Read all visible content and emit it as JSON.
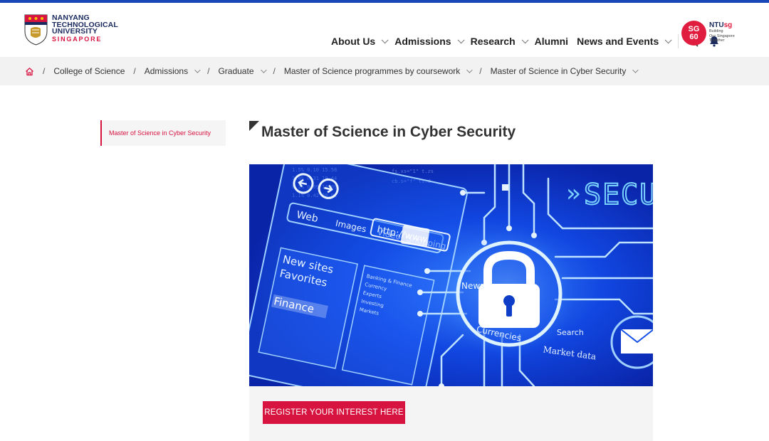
{
  "brand": {
    "line1": "NANYANG",
    "line2": "TECHNOLOGICAL",
    "line3": "UNIVERSITY",
    "line4": "SINGAPORE",
    "sg60_line1": "SG",
    "sg60_line2": "60",
    "ntusg_prefix": "NTU",
    "ntusg_suffix": "sg",
    "ntusg_tag1": "Building",
    "ntusg_tag2": "Our Singapore",
    "ntusg_tag3": "Together"
  },
  "nav": {
    "items": [
      {
        "label": "About Us"
      },
      {
        "label": "Admissions"
      },
      {
        "label": "Research"
      },
      {
        "label": "Alumni"
      },
      {
        "label": "News and Events"
      }
    ]
  },
  "breadcrumb": {
    "items": [
      {
        "label": "College of Science"
      },
      {
        "label": "Admissions"
      },
      {
        "label": "Graduate"
      },
      {
        "label": "Master of Science programmes by coursework"
      },
      {
        "label": "Master of Science in Cyber Security"
      }
    ]
  },
  "sidebar": {
    "active_item": "Master of Science in Cyber Security"
  },
  "main": {
    "title": "Master of Science in Cyber Security",
    "cta_label": "REGISTER YOUR INTEREST HERE",
    "hero_texts": {
      "secur": "SECUR",
      "web": "Web",
      "images": "Images",
      "video": "Video",
      "shopping": "Shopping",
      "http": "http://www",
      "news": "News",
      "new_sites": "New sites",
      "favorites": "Favorites",
      "finance": "Finance",
      "currencies": "Currencies",
      "market_data": "Market data",
      "search": "Search"
    }
  },
  "colors": {
    "accent": "#d71440",
    "brand_blue": "#1b2a5e",
    "top_bar": "#1a47b8"
  }
}
